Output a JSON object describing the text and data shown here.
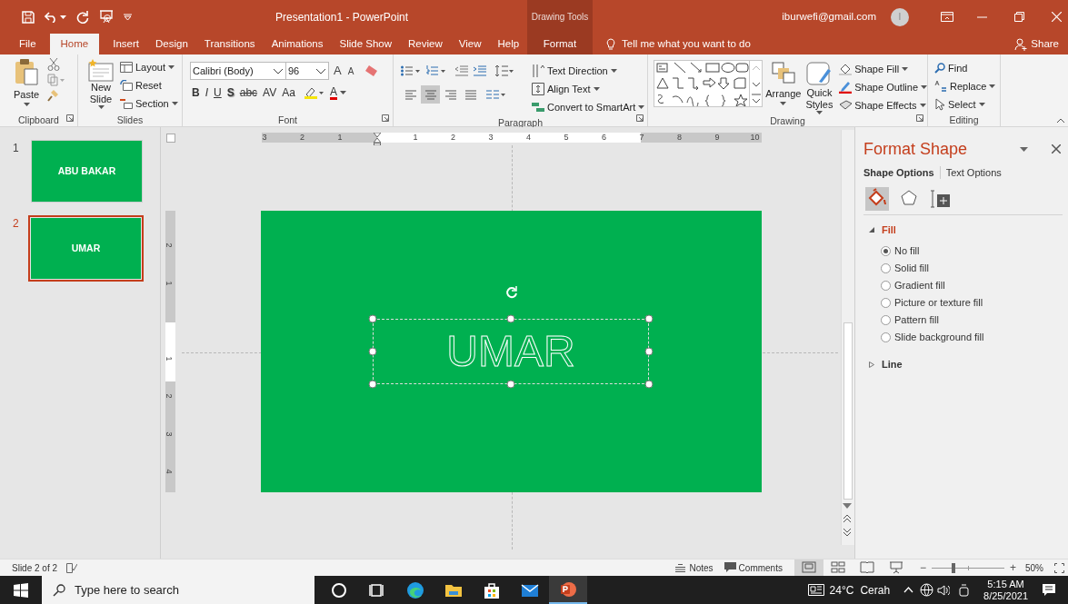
{
  "title_bar": {
    "title": "Presentation1  -  PowerPoint",
    "context_label": "Drawing Tools",
    "account": "iburwefi@gmail.com",
    "avatar_initial": "I"
  },
  "ribbon_tabs": [
    {
      "label": "File",
      "selected": false
    },
    {
      "label": "Home",
      "selected": true
    },
    {
      "label": "Insert",
      "selected": false
    },
    {
      "label": "Design",
      "selected": false
    },
    {
      "label": "Transitions",
      "selected": false
    },
    {
      "label": "Animations",
      "selected": false
    },
    {
      "label": "Slide Show",
      "selected": false
    },
    {
      "label": "Review",
      "selected": false
    },
    {
      "label": "View",
      "selected": false
    },
    {
      "label": "Help",
      "selected": false
    }
  ],
  "context_tab": {
    "label": "Format",
    "selected": false
  },
  "tell_me": "Tell me what you want to do",
  "share": "Share",
  "clipboard": {
    "paste": "Paste",
    "group": "Clipboard"
  },
  "slides_group": {
    "new_slide": "New Slide",
    "layout": "Layout",
    "reset": "Reset",
    "section": "Section",
    "group": "Slides"
  },
  "font": {
    "name": "Calibri (Body)",
    "size": "96",
    "grow": "A",
    "shrink": "A",
    "styles": [
      {
        "kind": "bold",
        "label": "B"
      },
      {
        "kind": "italic",
        "label": "I"
      },
      {
        "kind": "underline",
        "label": "U"
      },
      {
        "kind": "shadow",
        "label": "S"
      },
      {
        "kind": "strike",
        "label": "abc"
      },
      {
        "kind": "spacing",
        "label": "AV"
      },
      {
        "kind": "case",
        "label": "Aa"
      }
    ],
    "color_letter": "A",
    "group": "Font"
  },
  "paragraph": {
    "alignments": [
      {
        "kind": "left",
        "selected": false
      },
      {
        "kind": "center",
        "selected": true
      },
      {
        "kind": "right",
        "selected": false
      },
      {
        "kind": "justify",
        "selected": false
      }
    ],
    "text_direction": "Text Direction",
    "align_text": "Align Text",
    "smartart": "Convert to SmartArt",
    "group": "Paragraph"
  },
  "drawing": {
    "arrange": "Arrange",
    "quick_styles": "Quick Styles",
    "shape_fill": "Shape Fill",
    "shape_outline": "Shape Outline",
    "shape_effects": "Shape Effects",
    "group": "Drawing"
  },
  "editing": {
    "find": "Find",
    "replace": "Replace",
    "select": "Select",
    "group": "Editing"
  },
  "slides": [
    {
      "number": "1",
      "title": "ABU BAKAR",
      "selected": false
    },
    {
      "number": "2",
      "title": "UMAR",
      "selected": true
    }
  ],
  "rulers": {
    "horizontal": [
      "3",
      "2",
      "1",
      "1",
      "2",
      "3",
      "4",
      "5",
      "6",
      "7",
      "8",
      "9",
      "10"
    ],
    "vertical": [
      "2",
      "1",
      "1",
      "2",
      "3",
      "4"
    ]
  },
  "slide": {
    "text": "UMAR"
  },
  "format_pane": {
    "title": "Format Shape",
    "tabs": [
      {
        "label": "Shape Options",
        "selected": true
      },
      {
        "label": "Text Options",
        "selected": false
      }
    ],
    "icon_tabs": [
      {
        "kind": "fill_line",
        "selected": true
      },
      {
        "kind": "effects",
        "selected": false
      },
      {
        "kind": "size",
        "selected": false
      }
    ],
    "sections": [
      {
        "label": "Fill",
        "expanded": true,
        "options": [
          {
            "label": "No fill",
            "selected": true
          },
          {
            "label": "Solid fill",
            "selected": false
          },
          {
            "label": "Gradient fill",
            "selected": false
          },
          {
            "label": "Picture or texture fill",
            "selected": false
          },
          {
            "label": "Pattern fill",
            "selected": false
          },
          {
            "label": "Slide background fill",
            "selected": false
          }
        ]
      },
      {
        "label": "Line",
        "expanded": false
      }
    ]
  },
  "status_bar": {
    "slide_info": "Slide 2 of 2",
    "notes": "Notes",
    "comments": "Comments",
    "views": [
      {
        "kind": "normal",
        "selected": true
      },
      {
        "kind": "sorter",
        "selected": false
      },
      {
        "kind": "reading",
        "selected": false
      },
      {
        "kind": "slideshow",
        "selected": false
      }
    ],
    "zoom": {
      "minus": "−",
      "plus": "+",
      "level": 0.3,
      "reading": "50%"
    }
  },
  "taskbar": {
    "search_placeholder": "Type here to search",
    "apps": [
      {
        "kind": "cortana",
        "selected": false
      },
      {
        "kind": "task_view",
        "selected": false
      },
      {
        "kind": "browser",
        "selected": false
      },
      {
        "kind": "folder",
        "selected": false
      },
      {
        "kind": "store",
        "selected": false
      },
      {
        "kind": "mail",
        "selected": false
      },
      {
        "kind": "presentation",
        "selected": true
      }
    ],
    "weather": "24°C",
    "weather_text": "Cerah",
    "time": "5:15 AM",
    "date": "8/25/2021"
  }
}
